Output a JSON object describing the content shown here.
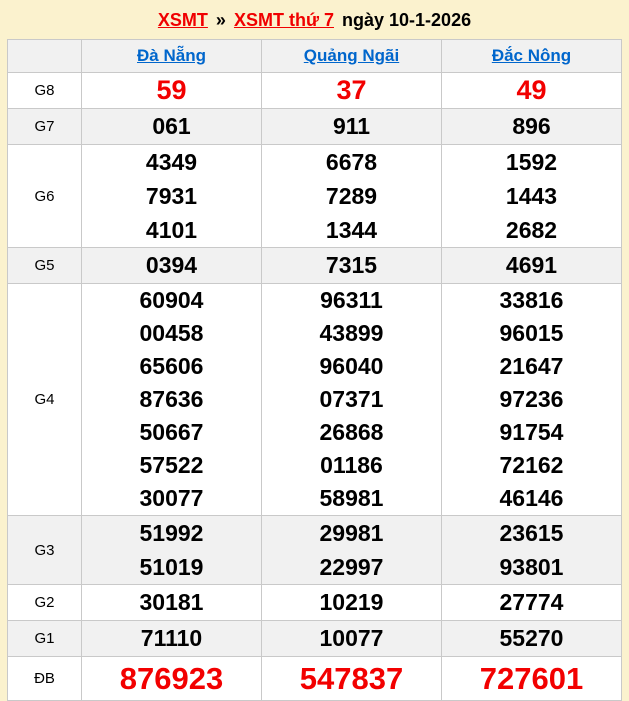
{
  "header": {
    "breadcrumb": [
      {
        "label": "XSMT",
        "type": "link"
      },
      {
        "label": "»",
        "type": "separator"
      },
      {
        "label": "XSMT thứ 7",
        "type": "link"
      },
      {
        "label": "ngày 10-1-2026",
        "type": "text"
      }
    ]
  },
  "table": {
    "columns": [
      "Đà Nẵng",
      "Quảng Ngãi",
      "Đắc Nông"
    ],
    "rows": [
      {
        "label": "G8",
        "highlight": "red-large",
        "cols": [
          [
            "59"
          ],
          [
            "37"
          ],
          [
            "49"
          ]
        ]
      },
      {
        "label": "G7",
        "highlight": "",
        "cols": [
          [
            "061"
          ],
          [
            "911"
          ],
          [
            "896"
          ]
        ]
      },
      {
        "label": "G6",
        "highlight": "",
        "cols": [
          [
            "4349",
            "7931",
            "4101"
          ],
          [
            "6678",
            "7289",
            "1344"
          ],
          [
            "1592",
            "1443",
            "2682"
          ]
        ]
      },
      {
        "label": "G5",
        "highlight": "",
        "cols": [
          [
            "0394"
          ],
          [
            "7315"
          ],
          [
            "4691"
          ]
        ]
      },
      {
        "label": "G4",
        "highlight": "",
        "cols": [
          [
            "60904",
            "00458",
            "65606",
            "87636",
            "50667",
            "57522",
            "30077"
          ],
          [
            "96311",
            "43899",
            "96040",
            "07371",
            "26868",
            "01186",
            "58981"
          ],
          [
            "33816",
            "96015",
            "21647",
            "97236",
            "91754",
            "72162",
            "46146"
          ]
        ]
      },
      {
        "label": "G3",
        "highlight": "",
        "cols": [
          [
            "51992",
            "51019"
          ],
          [
            "29981",
            "22997"
          ],
          [
            "23615",
            "93801"
          ]
        ]
      },
      {
        "label": "G2",
        "highlight": "",
        "cols": [
          [
            "30181"
          ],
          [
            "10219"
          ],
          [
            "27774"
          ]
        ]
      },
      {
        "label": "G1",
        "highlight": "",
        "cols": [
          [
            "71110"
          ],
          [
            "10077"
          ],
          [
            "55270"
          ]
        ]
      },
      {
        "label": "ĐB",
        "highlight": "red-huge",
        "cols": [
          [
            "876923"
          ],
          [
            "547837"
          ],
          [
            "727601"
          ]
        ]
      }
    ]
  },
  "colors": {
    "page_bg": "#FBF2CE",
    "accent_red": "#F20000",
    "link_blue": "#0066CC",
    "stripe_gray": "#F1F1F1",
    "border_gray": "#C9C9C9"
  }
}
